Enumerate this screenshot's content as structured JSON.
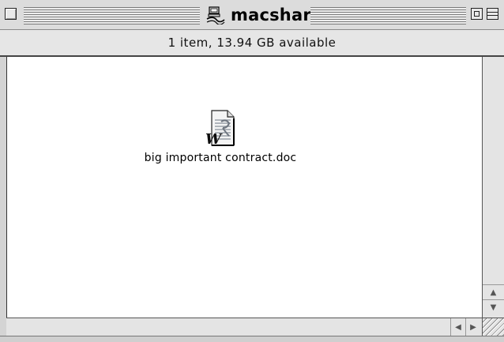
{
  "window": {
    "title": "macshare",
    "title_icon": "network-volume-icon"
  },
  "info": {
    "status": "1 item, 13.94 GB available"
  },
  "files": [
    {
      "name": "big important contract.doc",
      "icon": "word-document-icon"
    }
  ],
  "colors": {
    "chrome": "#dcdcdc",
    "content_bg": "#ffffff"
  }
}
